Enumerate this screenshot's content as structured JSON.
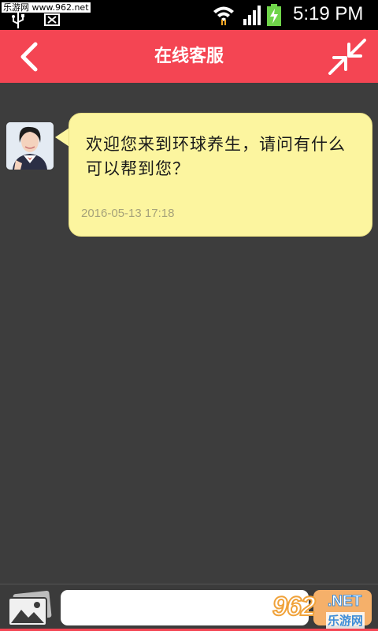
{
  "status_bar": {
    "watermark": "乐游网 www.962.net",
    "time": "5:19 PM",
    "icons": [
      "usb-icon",
      "x-icon",
      "wifi-icon",
      "signal-icon",
      "battery-icon"
    ]
  },
  "header": {
    "title": "在线客服",
    "back_icon": "chevron-left-icon",
    "minimize_icon": "minimize-arrows-icon",
    "background": "#f44553"
  },
  "chat": {
    "messages": [
      {
        "sender_avatar": "agent-avatar",
        "text": "欢迎您来到环球养生，请问有什么可以帮到您？",
        "time": "2016-05-13 17:18",
        "bubble_color": "#fcf59f"
      }
    ]
  },
  "composer": {
    "image_icon": "image-icon",
    "input_value": "",
    "input_placeholder": "",
    "send_label": ""
  },
  "overlay_logo": {
    "number": "962",
    "suffix": ".NET",
    "site_name": "乐游网"
  }
}
